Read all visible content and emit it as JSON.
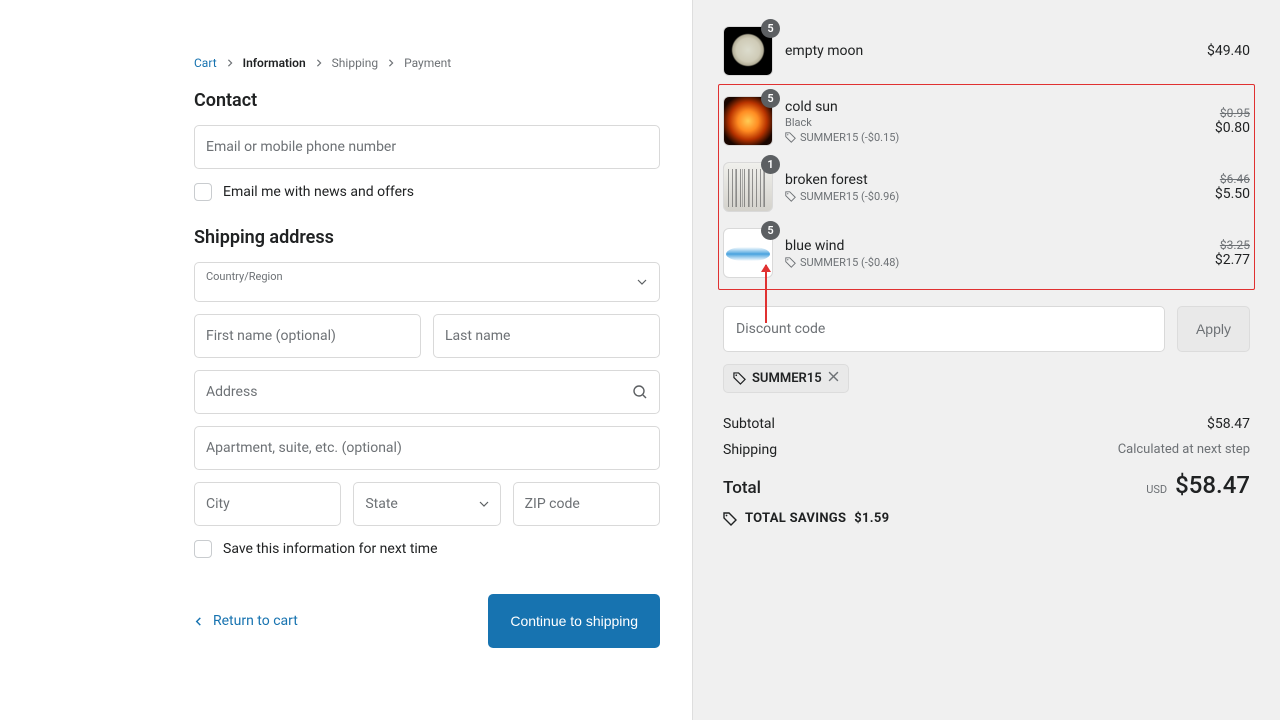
{
  "breadcrumbs": {
    "cart": "Cart",
    "info": "Information",
    "ship": "Shipping",
    "pay": "Payment"
  },
  "contact": {
    "heading": "Contact",
    "email_placeholder": "Email or mobile phone number",
    "news_label": "Email me with news and offers"
  },
  "shipping": {
    "heading": "Shipping address",
    "country_label": "Country/Region",
    "first_placeholder": "First name (optional)",
    "last_placeholder": "Last name",
    "address_placeholder": "Address",
    "apt_placeholder": "Apartment, suite, etc. (optional)",
    "city_placeholder": "City",
    "state_placeholder": "State",
    "zip_placeholder": "ZIP code",
    "save_label": "Save this information for next time"
  },
  "actions": {
    "return": "Return to cart",
    "continue": "Continue to shipping"
  },
  "cart": {
    "items": [
      {
        "name": "empty moon",
        "qty": "5",
        "price": "$49.40"
      },
      {
        "name": "cold sun",
        "variant": "Black",
        "qty": "5",
        "discount": "SUMMER15 (-$0.15)",
        "orig": "$0.95",
        "price": "$0.80"
      },
      {
        "name": "broken forest",
        "qty": "1",
        "discount": "SUMMER15 (-$0.96)",
        "orig": "$6.46",
        "price": "$5.50"
      },
      {
        "name": "blue wind",
        "qty": "5",
        "discount": "SUMMER15 (-$0.48)",
        "orig": "$3.25",
        "price": "$2.77"
      }
    ],
    "promo_placeholder": "Discount code",
    "apply": "Apply",
    "chip": "SUMMER15",
    "subtotal_label": "Subtotal",
    "subtotal": "$58.47",
    "shipping_label": "Shipping",
    "shipping_note": "Calculated at next step",
    "total_label": "Total",
    "currency": "USD",
    "total": "$58.47",
    "savings_label": "TOTAL SAVINGS",
    "savings": "$1.59"
  }
}
